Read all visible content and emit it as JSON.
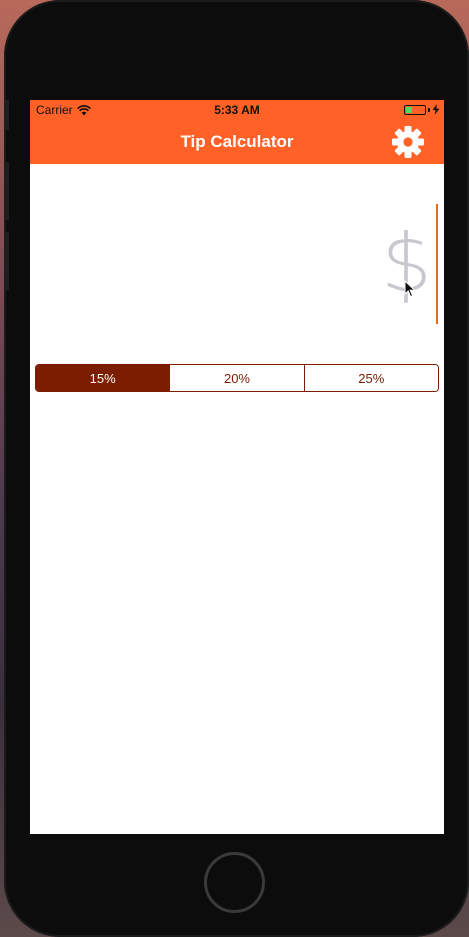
{
  "status_bar": {
    "carrier": "Carrier",
    "time": "5:33 AM",
    "battery_level": 0.35,
    "battery_color": "#4cd964"
  },
  "nav": {
    "title": "Tip Calculator",
    "settings_icon": "gear-icon"
  },
  "bill": {
    "placeholder": "$",
    "value": ""
  },
  "tip_selector": {
    "options": [
      "15%",
      "20%",
      "25%"
    ],
    "selected_index": 0
  },
  "colors": {
    "accent": "#ff6127",
    "segment_tint": "#7b1d00",
    "placeholder_gray": "#c7c7cd"
  }
}
